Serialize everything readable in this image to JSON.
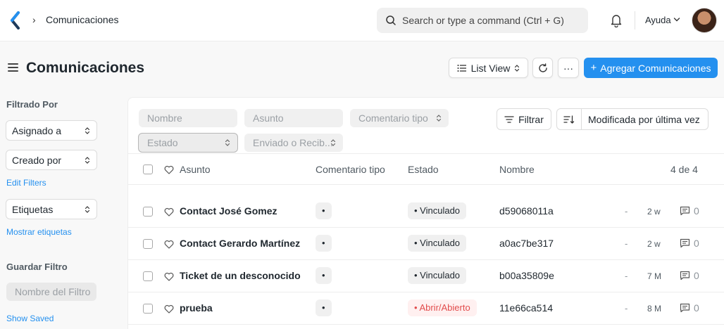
{
  "navbar": {
    "breadcrumb": "Comunicaciones",
    "breadcrumb_sep": "›",
    "search_placeholder": "Search or type a command (Ctrl + G)",
    "help_label": "Ayuda"
  },
  "header": {
    "title": "Comunicaciones",
    "view_label": "List View",
    "more_label": "···",
    "primary_label": "Agregar Comunicaciones",
    "primary_plus": "+"
  },
  "sidebar": {
    "filter_heading": "Filtrado Por",
    "assigned_to": "Asignado a",
    "created_by": "Creado por",
    "edit_filters": "Edit Filters",
    "tags": "Etiquetas",
    "show_tags": "Mostrar etiquetas",
    "save_heading": "Guardar Filtro",
    "filter_name_placeholder": "Nombre del Filtro",
    "show_saved": "Show Saved"
  },
  "filters": {
    "nombre": "Nombre",
    "asunto": "Asunto",
    "comentario_tipo": "Comentario tipo",
    "estado": "Estado",
    "enviado": "Enviado o Recib...",
    "filter_button": "Filtrar",
    "sort_label": "Modificada por última vez"
  },
  "list": {
    "columns": {
      "subject": "Asunto",
      "comment_type": "Comentario tipo",
      "status": "Estado",
      "name": "Nombre",
      "count": "4 de 4"
    },
    "rows": [
      {
        "subject": "Contact José Gomez",
        "comment_type": "•",
        "status": "• Vinculado",
        "name": "d59068011a",
        "dash": "-",
        "ago": "2 w",
        "comments": "0"
      },
      {
        "subject": "Contact Gerardo Martínez",
        "comment_type": "•",
        "status": "• Vinculado",
        "name": "a0ac7be317",
        "dash": "-",
        "ago": "2 w",
        "comments": "0"
      },
      {
        "subject": "Ticket de un desconocido",
        "comment_type": "•",
        "status": "• Vinculado",
        "name": "b00a35809e",
        "dash": "-",
        "ago": "7 M",
        "comments": "0"
      },
      {
        "subject": "prueba",
        "comment_type": "•",
        "status": "• Abrir/Abierto",
        "name": "11e66ca514",
        "dash": "-",
        "ago": "8 M",
        "comments": "0"
      }
    ]
  },
  "colors": {
    "primary": "#2490ef",
    "danger_text": "#e24c4c",
    "danger_bg": "#fff0f0"
  }
}
